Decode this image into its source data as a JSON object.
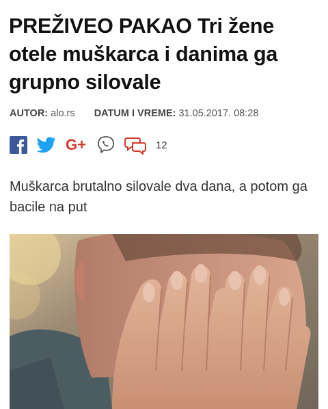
{
  "article": {
    "title": "PREŽIVEO PAKAO Tri žene otele muškarca i danima ga grupno silovale",
    "author_label": "AUTOR:",
    "author": "alo.rs",
    "date_label": "DATUM I VREME:",
    "date": "31.05.2017. 08:28",
    "lead": "Muškarca brutalno silovale dva dana, a potom ga bacile na put"
  },
  "share": {
    "icons": [
      "facebook-icon",
      "twitter-icon",
      "google-plus-icon",
      "viber-icon",
      "comments-icon"
    ],
    "google_plus_text": "G+",
    "comment_count": "12",
    "colors": {
      "facebook": "#3b5998",
      "twitter": "#1da1f2",
      "google_plus": "#d23a2b",
      "viber": "#7b519d",
      "comments": "#d23a2b"
    }
  },
  "image": {
    "subject": "man covering face with hands"
  }
}
